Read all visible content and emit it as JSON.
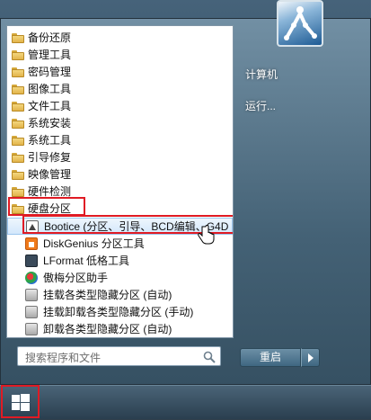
{
  "start_menu": {
    "programs": [
      {
        "label": "备份还原",
        "kind": "folder"
      },
      {
        "label": "管理工具",
        "kind": "folder"
      },
      {
        "label": "密码管理",
        "kind": "folder"
      },
      {
        "label": "图像工具",
        "kind": "folder"
      },
      {
        "label": "文件工具",
        "kind": "folder"
      },
      {
        "label": "系统安装",
        "kind": "folder"
      },
      {
        "label": "系统工具",
        "kind": "folder"
      },
      {
        "label": "引导修复",
        "kind": "folder"
      },
      {
        "label": "映像管理",
        "kind": "folder"
      },
      {
        "label": "硬件检测",
        "kind": "folder"
      },
      {
        "label": "硬盘分区",
        "kind": "folder",
        "highlighted": true
      },
      {
        "label": "Bootice (分区、引导、BCD编辑、G4D",
        "kind": "app",
        "icon": "bootice-icon",
        "selected": true
      },
      {
        "label": "DiskGenius 分区工具",
        "kind": "app",
        "icon": "diskgenius-icon"
      },
      {
        "label": "LFormat 低格工具",
        "kind": "app",
        "icon": "lformat-icon"
      },
      {
        "label": "傲梅分区助手",
        "kind": "app",
        "icon": "aomei-icon"
      },
      {
        "label": "挂载各类型隐藏分区 (自动)",
        "kind": "app",
        "icon": "drive-icon"
      },
      {
        "label": "挂载卸载各类型隐藏分区 (手动)",
        "kind": "app",
        "icon": "drive-icon"
      },
      {
        "label": "卸载各类型隐藏分区 (自动)",
        "kind": "app",
        "icon": "drive-icon"
      }
    ],
    "search": {
      "placeholder": "搜索程序和文件"
    },
    "right_links": {
      "computer": "计算机",
      "run": "运行..."
    },
    "shutdown": {
      "label": "重启"
    }
  },
  "colors": {
    "highlight_border": "#e01b24",
    "selection": "#d3e7fb"
  }
}
